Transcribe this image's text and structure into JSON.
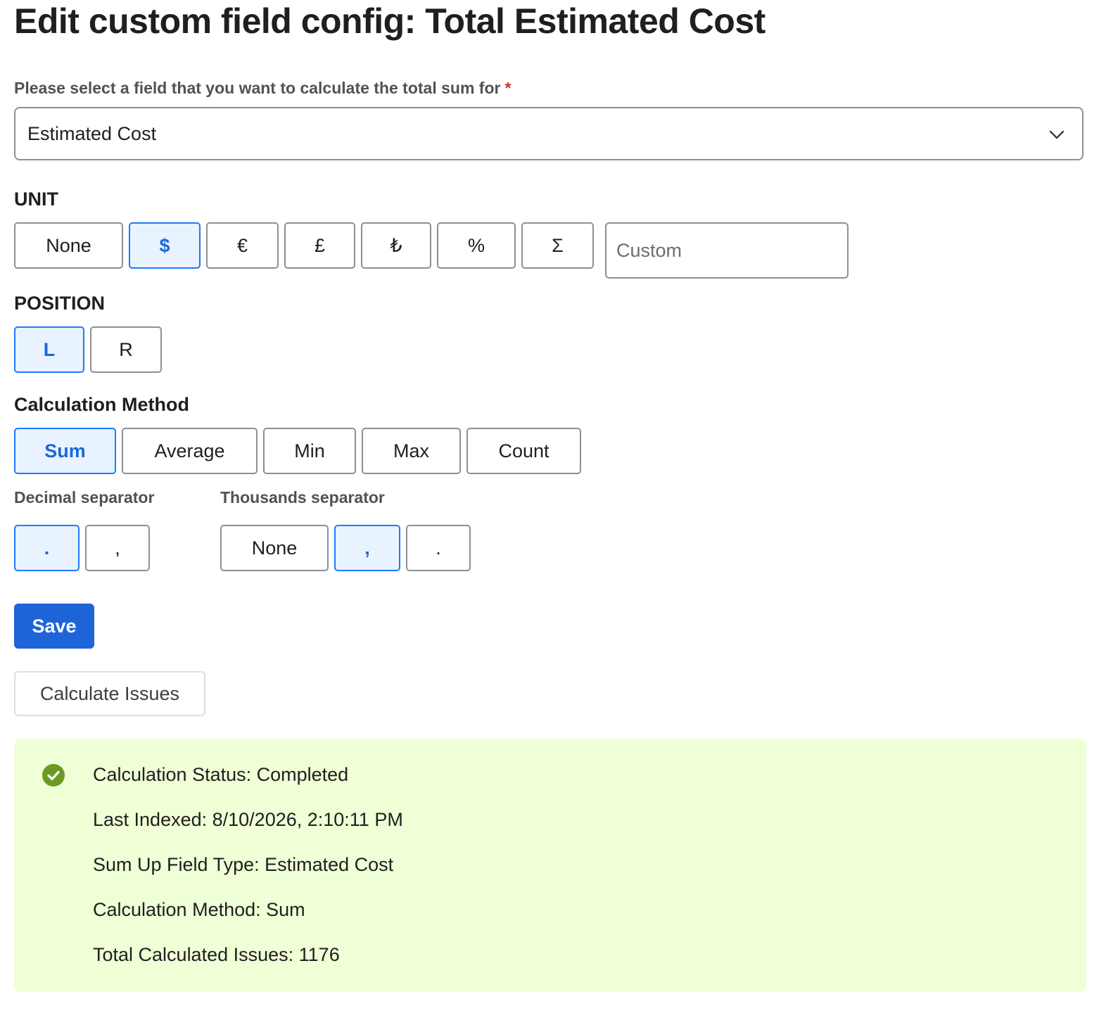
{
  "page": {
    "title": "Edit custom field config: Total Estimated Cost"
  },
  "field_select": {
    "label": "Please select a field that you want to calculate the total sum for",
    "required_mark": "*",
    "value": "Estimated Cost"
  },
  "unit": {
    "heading": "UNIT",
    "options": [
      "None",
      "$",
      "€",
      "£",
      "₺",
      "%",
      "Σ"
    ],
    "selected": "$",
    "custom_placeholder": "Custom"
  },
  "position": {
    "heading": "POSITION",
    "options": [
      "L",
      "R"
    ],
    "selected": "L"
  },
  "calculation_method": {
    "heading": "Calculation Method",
    "options": [
      "Sum",
      "Average",
      "Min",
      "Max",
      "Count"
    ],
    "selected": "Sum"
  },
  "decimal_separator": {
    "heading": "Decimal separator",
    "options": [
      ".",
      ","
    ],
    "selected": "."
  },
  "thousands_separator": {
    "heading": "Thousands separator",
    "options": [
      "None",
      ",",
      "."
    ],
    "selected": ","
  },
  "actions": {
    "save_label": "Save",
    "calculate_label": "Calculate Issues"
  },
  "status": {
    "icon": "check-circle-icon",
    "lines": [
      "Calculation Status: Completed",
      "Last Indexed: 8/10/2026, 2:10:11 PM",
      "Sum Up Field Type: Estimated Cost",
      "Calculation Method: Sum",
      "Total Calculated Issues: 1176"
    ]
  },
  "colors": {
    "accent": "#1d64d8",
    "selected_bg": "#e9f2ff",
    "selected_text": "#1868db",
    "success_bg": "#efffd6",
    "success_icon": "#6a9a23",
    "required": "#c9372c"
  }
}
